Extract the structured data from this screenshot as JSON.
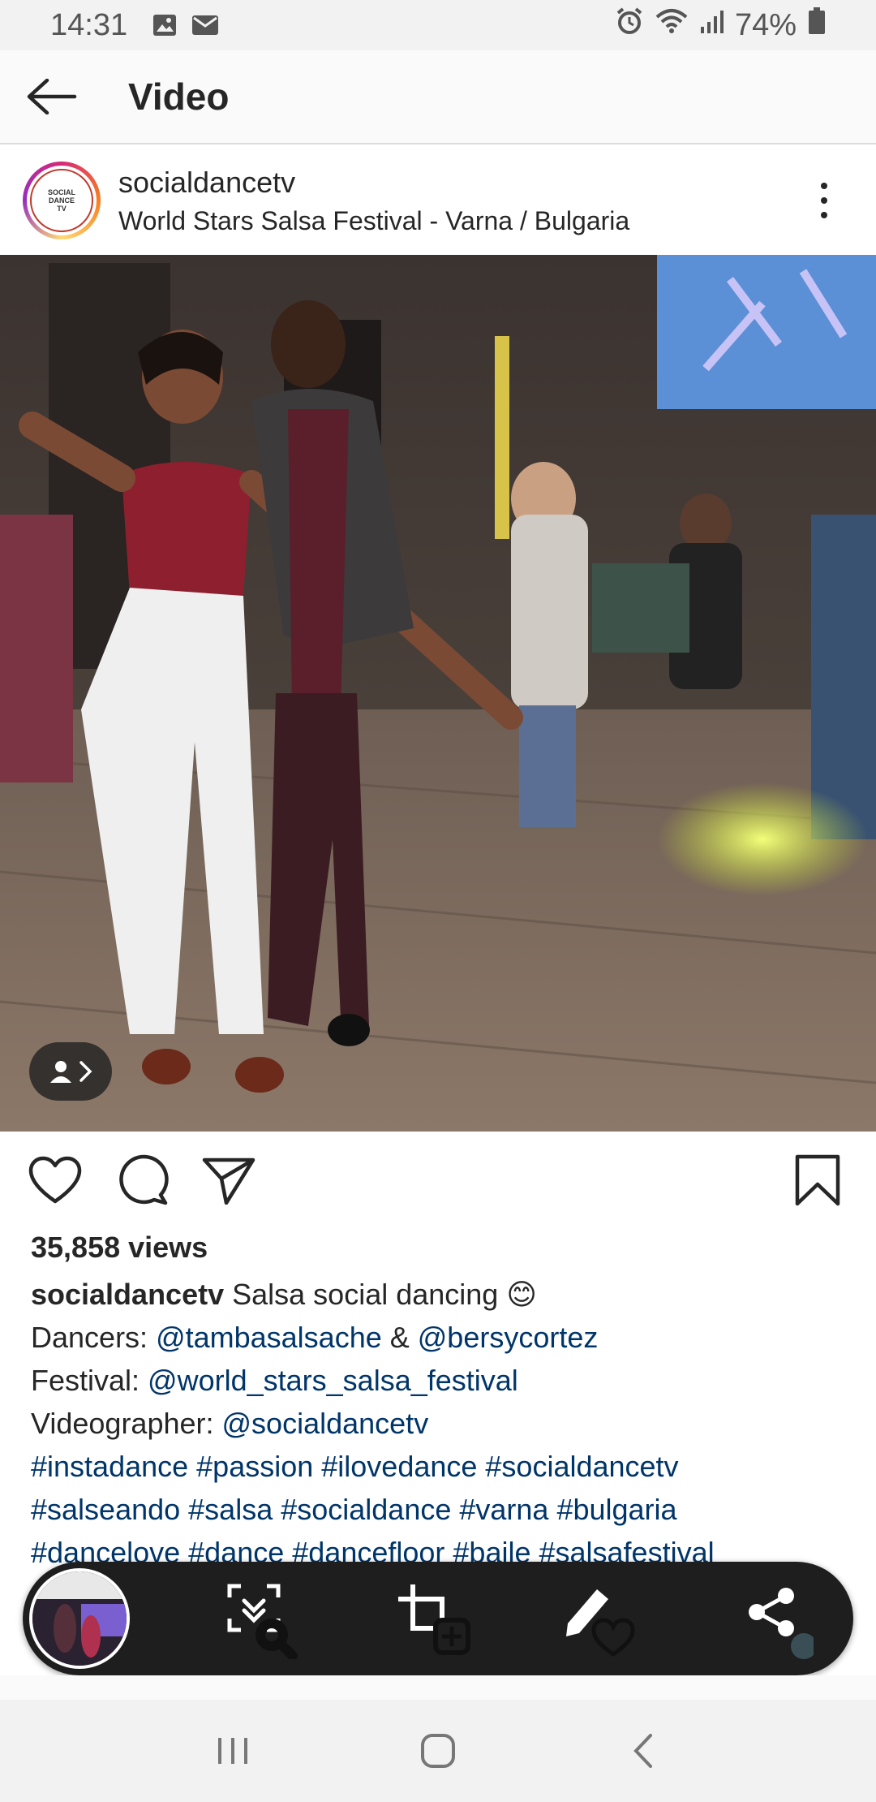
{
  "status_bar": {
    "time": "14:31",
    "battery": "74%",
    "icons": [
      "gallery-icon",
      "mail-icon",
      "alarm-icon",
      "wifi-icon",
      "signal-icon",
      "battery-icon"
    ]
  },
  "header": {
    "title": "Video"
  },
  "post": {
    "username": "socialdancetv",
    "location": "World Stars Salsa Festival - Varna / Bulgaria",
    "avatar_text": [
      "SOCIAL",
      "DANCE",
      "TV"
    ]
  },
  "stats": {
    "views": "35,858 views"
  },
  "caption": {
    "username": "socialdancetv",
    "text": " Salsa social dancing 😊",
    "dancers_label": "Dancers: ",
    "dancer_1": "@tambasalsache",
    "dancers_sep": " & ",
    "dancer_2": "@bersycortez",
    "festival_label": "Festival: ",
    "festival": "@world_stars_salsa_festival",
    "videographer_label": "Videographer: ",
    "videographer": "@socialdancetv",
    "hashtags_line1": "#instadance #passion #ilovedance #socialdancetv",
    "hashtags_line2": "#salseando #salsa #socialdance #varna #bulgaria",
    "hashtags_line3": "#dancelove #dance #dancefloor #baile #salsafestival"
  },
  "colors": {
    "link": "#003569",
    "toolbar_bg": "#1e1e1e",
    "status_bg": "#f2f2f2"
  }
}
